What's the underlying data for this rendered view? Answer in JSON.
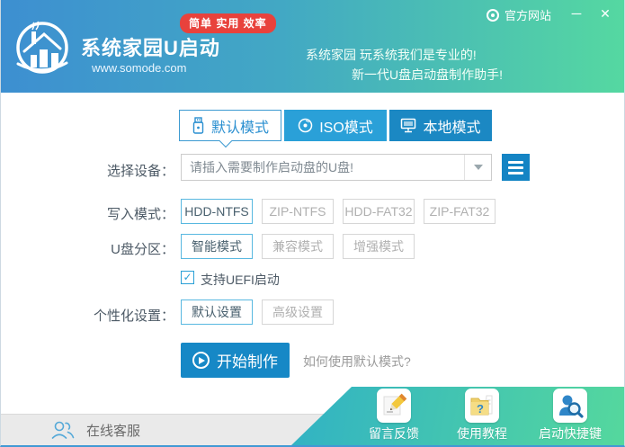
{
  "window": {
    "official_site_label": "官方网站",
    "minimize_glyph": "─",
    "close_glyph": "✕"
  },
  "header": {
    "badge": "简单 实用 效率",
    "title": "系统家园U启动",
    "url": "www.somode.com",
    "slogan_line1": "系统家园 玩系统我们是专业的!",
    "slogan_line2": "新一代U盘启动盘制作助手!"
  },
  "tabs": [
    {
      "label": "默认模式",
      "active": true
    },
    {
      "label": "ISO模式",
      "active": false
    },
    {
      "label": "本地模式",
      "active": false
    }
  ],
  "device_row": {
    "label": "选择设备：",
    "placeholder": "请插入需要制作启动盘的U盘!"
  },
  "write_mode_row": {
    "label": "写入模式：",
    "options": [
      {
        "label": "HDD-NTFS",
        "selected": true
      },
      {
        "label": "ZIP-NTFS",
        "selected": false
      },
      {
        "label": "HDD-FAT32",
        "selected": false
      },
      {
        "label": "ZIP-FAT32",
        "selected": false
      }
    ]
  },
  "partition_row": {
    "label": "U盘分区：",
    "options": [
      {
        "label": "智能模式",
        "selected": true
      },
      {
        "label": "兼容模式",
        "selected": false
      },
      {
        "label": "增强模式",
        "selected": false
      }
    ]
  },
  "uefi": {
    "label": "支持UEFI启动",
    "checked": true,
    "check_glyph": "✓"
  },
  "personalize_row": {
    "label": "个性化设置：",
    "options": [
      {
        "label": "默认设置",
        "selected": true
      },
      {
        "label": "高级设置",
        "selected": false
      }
    ]
  },
  "actions": {
    "start_label": "开始制作",
    "help_link": "如何使用默认模式?"
  },
  "footer": {
    "support_label": "在线客服",
    "shortcuts": [
      {
        "label": "留言反馈"
      },
      {
        "label": "使用教程"
      },
      {
        "label": "启动快捷键"
      }
    ]
  },
  "colors": {
    "header_blue": "#3d8fd1",
    "header_green": "#55d8a1",
    "primary_blue": "#1688c6",
    "tab_iso_bg": "#2aa0d8",
    "tab_local_bg": "#1b88c3",
    "badge_red": "#e8423c",
    "selected_border": "#58b8e0",
    "teal_left": "#31b2c4",
    "teal_right": "#55d89d"
  }
}
